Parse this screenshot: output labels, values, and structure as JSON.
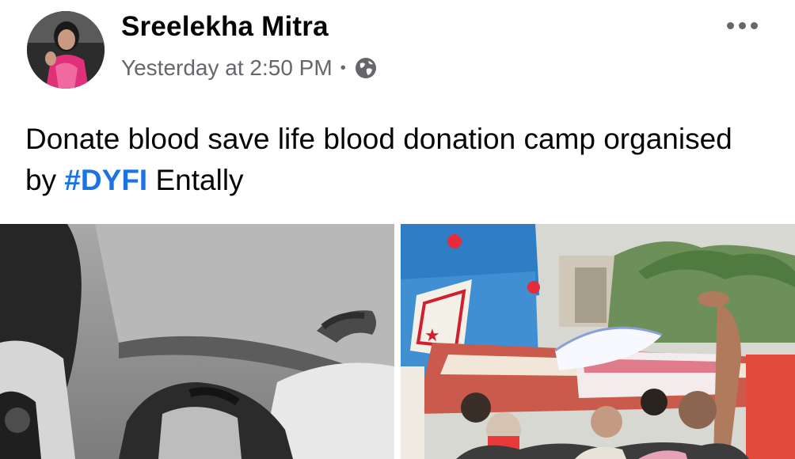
{
  "post": {
    "author": "Sreelekha Mitra",
    "timestamp": "Yesterday at 2:50 PM",
    "separator": "•",
    "privacy_icon": "globe-icon",
    "more_icon": "more-dots-icon",
    "text_before_hashtag": "Donate blood save life blood donation camp organised by ",
    "hashtag": "#DYFI",
    "text_after_hashtag": " Entally"
  },
  "photos": [
    {
      "name": "car-selfie-photo"
    },
    {
      "name": "blood-donation-camp-photo"
    }
  ],
  "colors": {
    "author": "#050505",
    "meta": "#65676b",
    "hashtag": "#1b74e4",
    "background": "#ffffff"
  }
}
